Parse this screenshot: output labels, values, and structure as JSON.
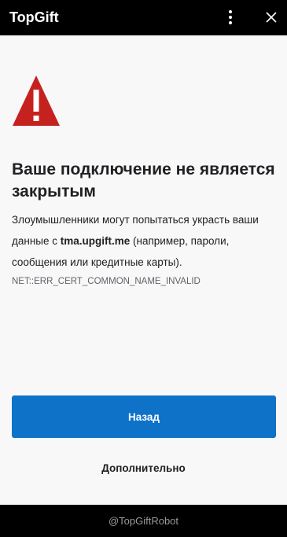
{
  "window": {
    "title": "TopGift",
    "menu_icon": "more-vertical-icon",
    "close_icon": "close-icon"
  },
  "error_page": {
    "warning_icon": "warning-triangle-icon",
    "heading": "Ваше подключение не является закрытым",
    "description_before": "Злоумышленники могут попытаться украсть ваши данные с ",
    "domain": "tma.upgift.me",
    "description_after": " (например, пароли, сообщения или кредитные карты).",
    "error_code": "NET::ERR_CERT_COMMON_NAME_INVALID",
    "back_label": "Назад",
    "advanced_label": "Дополнительно"
  },
  "footer": {
    "text": "@TopGiftRobot"
  },
  "colors": {
    "titlebar_bg": "#000000",
    "page_bg": "#f8f8f8",
    "warning_red": "#c5221f",
    "button_blue": "#0f72c9",
    "footer_text": "#9a9a9a"
  }
}
